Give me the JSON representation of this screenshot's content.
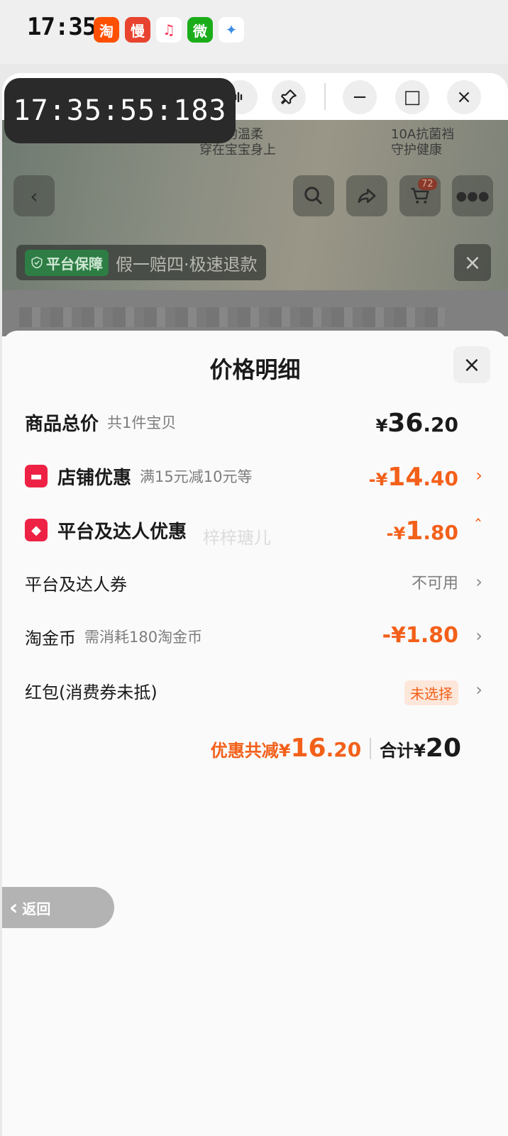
{
  "status_bar": {
    "time": "17:35",
    "apps": [
      {
        "label": "淘",
        "icon": "taobao-icon",
        "color": "#ff5000"
      },
      {
        "label": "慢",
        "icon": "manman-icon",
        "color": "#e8432e"
      },
      {
        "label": "♫",
        "icon": "music-icon",
        "color": "#ffffff"
      },
      {
        "label": "微",
        "icon": "wechat-icon",
        "color": "#1aad19"
      },
      {
        "label": "✦",
        "icon": "pinwheel-icon",
        "color": "#ffffff"
      }
    ]
  },
  "window_toolbar": {
    "minimize": "−",
    "maximize": "□",
    "close": "×"
  },
  "timer": "17:35:55:183",
  "background_page": {
    "banner_left": "自然的温柔\n穿在宝宝身上",
    "banner_right": "10A抗菌裆\n守护健康",
    "cart_count": "72",
    "guarantee_badge": "平台保障",
    "guarantee_text": "假一赔四·极速退款"
  },
  "sheet": {
    "title": "价格明细",
    "rows": {
      "total": {
        "label": "商品总价",
        "sub": "共1件宝贝",
        "yen": "¥",
        "int": "36",
        "dec": ".20"
      },
      "shop": {
        "label": "店铺优惠",
        "sub": "满15元减10元等",
        "yen": "-¥",
        "int": "14",
        "dec": ".40"
      },
      "platform": {
        "label": "平台及达人优惠",
        "yen": "-¥",
        "int": "1",
        "dec": ".80"
      },
      "coupon": {
        "label": "平台及达人券",
        "value": "不可用"
      },
      "gold": {
        "label": "淘金币",
        "sub": "需消耗180淘金币",
        "value": "-¥1.80"
      },
      "redpacket": {
        "label": "红包(消费券未抵)",
        "value": "未选择"
      }
    },
    "watermark": "梓梓瑭儿",
    "summary": {
      "discount_label": "优惠共减",
      "discount_yen": "¥",
      "discount_int": "16",
      "discount_dec": ".20",
      "total_label": "合计",
      "total_yen": "¥",
      "total_value": "20"
    }
  },
  "back_button": "返回",
  "colors": {
    "accent": "#f3601a",
    "danger_icon": "#ee2244"
  }
}
